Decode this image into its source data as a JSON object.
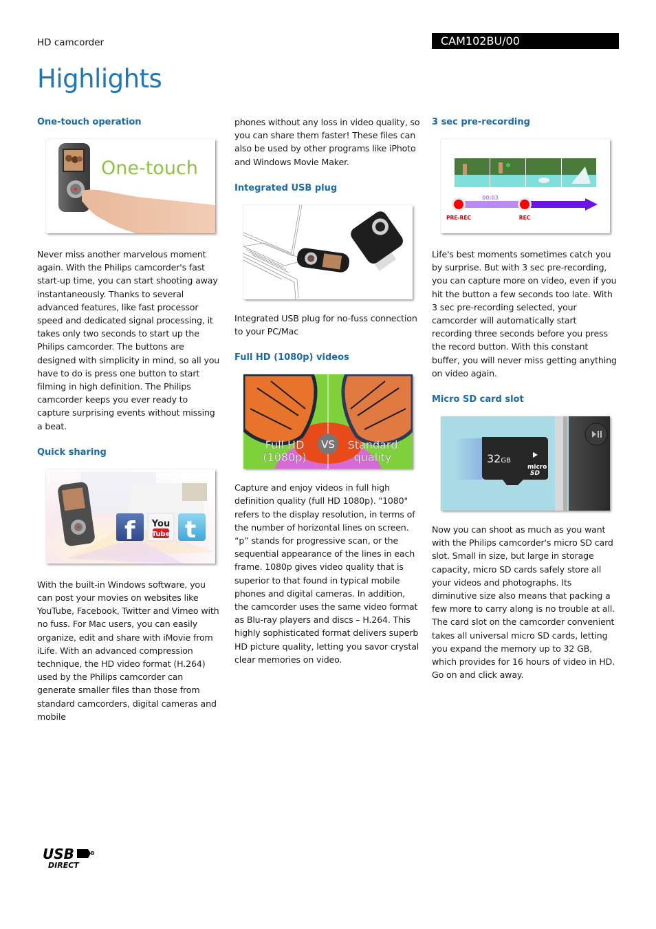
{
  "header": {
    "product_type": "HD camcorder",
    "model": "CAM102BU/00",
    "title": "Highlights"
  },
  "colors": {
    "heading": "#1a6aa8",
    "title": "#1f77b8",
    "pre_rec_dot": "#ff0000",
    "timeline_light": "#b98af0",
    "timeline_dark": "#6a14e6",
    "sd_background": "#a8dbe6"
  },
  "sections": {
    "one_touch": {
      "heading": "One-touch operation",
      "image_caption": "One-touch",
      "body": "Never miss another marvelous moment again. With the Philips camcorder's fast start-up time, you can start shooting away instantaneously. Thanks to several advanced features, like fast processor speed and dedicated signal processing, it takes only two seconds to start up the Philips camcorder. The buttons are designed with simplicity in mind, so all you have to do is press one button to start filming in high definition. The Philips camcorder keeps you ever ready to capture surprising events without missing a beat."
    },
    "quick_sharing": {
      "heading": "Quick sharing",
      "icons": [
        "facebook-icon",
        "youtube-icon",
        "twitter-icon"
      ],
      "youtube_top": "You",
      "youtube_bottom": "Tube",
      "facebook_letter": "f",
      "twitter_letter": "t",
      "body": "With the built-in Windows software, you can post your movies on websites like YouTube, Facebook, Twitter and Vimeo with no fuss. For Mac users, you can easily organize, edit and share with iMovie from iLife. With an advanced compression technique, the HD video format (H.264) used by the Philips camcorder can generate smaller files than those from standard camcorders, digital cameras and mobile",
      "body_continued": "phones without any loss in video quality, so you can share them faster! These files can also be used by other programs like iPhoto and Windows Movie Maker."
    },
    "usb_plug": {
      "heading": "Integrated USB plug",
      "body": "Integrated USB plug for no-fuss connection to your PC/Mac"
    },
    "full_hd": {
      "heading": "Full HD (1080p) videos",
      "label_left_1": "Full HD",
      "label_left_2": "(1080p)",
      "label_vs": "VS",
      "label_right_1": "Standard",
      "label_right_2": "quality",
      "body": "Capture and enjoy videos in full high definition quality (full HD 1080p). \"1080\" refers to the display resolution, in terms of the number of horizontal lines on screen. “p” stands for progressive scan, or the sequential appearance of the lines in each frame. 1080p gives video quality that is superior to that found in typical mobile phones and digital cameras. In addition, the camcorder uses the same video format as Blu-ray players and discs – H.264. This highly sophisticated format delivers superb HD picture quality, letting you savor crystal clear memories on video."
    },
    "pre_recording": {
      "heading": "3 sec pre-recording",
      "timer": "00:03",
      "pre_rec_label": "PRE-REC",
      "rec_label": "REC",
      "body": "Life's best moments sometimes catch you by surprise. But with 3 sec pre-recording, you can capture more on video, even if you hit the button a few seconds too late. With 3 sec pre-recording selected, your camcorder will automatically start recording three seconds before you press the record button. With this constant buffer, you will never miss getting anything on video again."
    },
    "micro_sd": {
      "heading": "Micro SD card slot",
      "card_capacity": "32",
      "card_unit": "GB",
      "card_brand_top": "micro",
      "card_brand_bottom": "SD",
      "body": "Now you can shoot as much as you want with the Philips camcorder's micro SD card slot. Small in size, but large in storage capacity, micro SD cards safely store all your videos and photographs. Its diminutive size also means that packing a few more to carry along is no trouble at all. The card slot on the camcorder convenient takes all universal micro SD cards, letting you expand the memory up to 32 GB, which provides for 16 hours of video in HD. Go on and click away."
    }
  },
  "footer": {
    "logo_main": "USB",
    "logo_sub": "DIRECT",
    "logo_mark": "B"
  }
}
